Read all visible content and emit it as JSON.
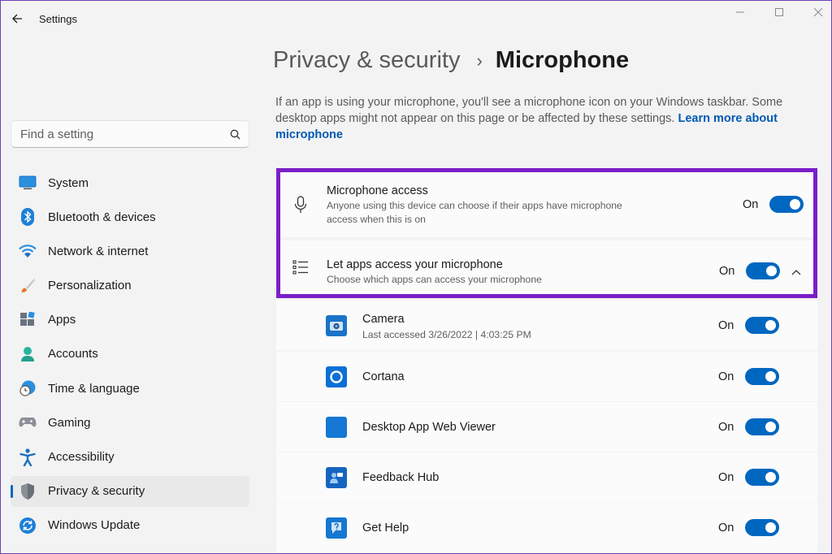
{
  "window": {
    "title": "Settings"
  },
  "search": {
    "placeholder": "Find a setting"
  },
  "sidebar": {
    "items": [
      {
        "label": "System",
        "icon": "system-icon",
        "active": false
      },
      {
        "label": "Bluetooth & devices",
        "icon": "bluetooth-icon",
        "active": false
      },
      {
        "label": "Network & internet",
        "icon": "wifi-icon",
        "active": false
      },
      {
        "label": "Personalization",
        "icon": "brush-icon",
        "active": false
      },
      {
        "label": "Apps",
        "icon": "apps-icon",
        "active": false
      },
      {
        "label": "Accounts",
        "icon": "account-icon",
        "active": false
      },
      {
        "label": "Time & language",
        "icon": "clock-globe-icon",
        "active": false
      },
      {
        "label": "Gaming",
        "icon": "gamepad-icon",
        "active": false
      },
      {
        "label": "Accessibility",
        "icon": "accessibility-icon",
        "active": false
      },
      {
        "label": "Privacy & security",
        "icon": "shield-icon",
        "active": true
      },
      {
        "label": "Windows Update",
        "icon": "update-icon",
        "active": false
      }
    ]
  },
  "breadcrumb": {
    "parent": "Privacy & security",
    "separator": "›",
    "current": "Microphone"
  },
  "description": {
    "text": "If an app is using your microphone, you'll see a microphone icon on your Windows taskbar. Some desktop apps might not appear on this page or be affected by these settings. ",
    "link": "Learn more about microphone"
  },
  "settings": {
    "mic_access": {
      "title": "Microphone access",
      "subtitle": "Anyone using this device can choose if their apps have microphone access when this is on",
      "state": "On"
    },
    "let_apps": {
      "title": "Let apps access your microphone",
      "subtitle": "Choose which apps can access your microphone",
      "state": "On"
    }
  },
  "apps": [
    {
      "name": "Camera",
      "sub": "Last accessed 3/26/2022  |  4:03:25 PM",
      "state": "On",
      "icon": "camera-icon",
      "color": "#1a73c8"
    },
    {
      "name": "Cortana",
      "sub": "",
      "state": "On",
      "icon": "cortana-icon",
      "color": "#0a6fd6"
    },
    {
      "name": "Desktop App Web Viewer",
      "sub": "",
      "state": "On",
      "icon": "web-viewer-icon",
      "color": "#1478d4"
    },
    {
      "name": "Feedback Hub",
      "sub": "",
      "state": "On",
      "icon": "feedback-hub-icon",
      "color": "#1565c0"
    },
    {
      "name": "Get Help",
      "sub": "",
      "state": "On",
      "icon": "get-help-icon",
      "color": "#1677d2"
    }
  ],
  "colors": {
    "accent": "#0067c0",
    "highlight": "#7b1fc9"
  }
}
